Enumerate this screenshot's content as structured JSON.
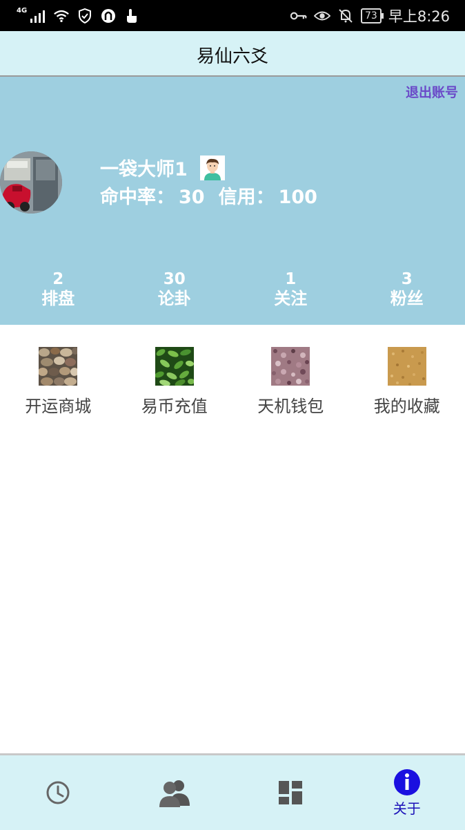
{
  "status_bar": {
    "network": "4G",
    "battery": "73",
    "time": "早上8:26"
  },
  "header": {
    "title": "易仙六爻"
  },
  "profile": {
    "logout_label": "退出账号",
    "username": "一袋大师1",
    "hit_rate_label": "命中率：",
    "hit_rate_value": "30",
    "credit_label": "信用：",
    "credit_value": "100",
    "counts": [
      {
        "value": "2",
        "label": "排盘"
      },
      {
        "value": "30",
        "label": "论卦"
      },
      {
        "value": "1",
        "label": "关注"
      },
      {
        "value": "3",
        "label": "粉丝"
      }
    ]
  },
  "menu": {
    "items": [
      {
        "label": "开运商城",
        "texture": "pebbles",
        "color": "#7a6a55"
      },
      {
        "label": "易币充值",
        "texture": "leaves",
        "color": "#3f7a2a"
      },
      {
        "label": "天机钱包",
        "texture": "granite",
        "color": "#9a6f78"
      },
      {
        "label": "我的收藏",
        "texture": "sand",
        "color": "#c99a4e"
      }
    ]
  },
  "bottom_nav": {
    "items": [
      {
        "icon": "clock-icon",
        "label": ""
      },
      {
        "icon": "people-icon",
        "label": ""
      },
      {
        "icon": "dashboard-icon",
        "label": ""
      },
      {
        "icon": "info-icon",
        "label": "关于",
        "active": true
      }
    ]
  }
}
